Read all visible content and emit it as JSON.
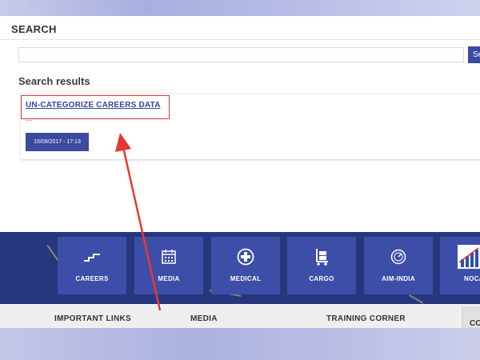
{
  "header": {
    "title": "SEARCH"
  },
  "search": {
    "value": "",
    "placeholder": "",
    "button_label": "Se"
  },
  "results": {
    "heading": "Search results",
    "items": [
      {
        "title": "UN-CATEGORIZE CAREERS DATA",
        "snippet": "...",
        "date": "15/09/2017 - 17:13"
      }
    ]
  },
  "tiles": [
    {
      "label": "CAREERS",
      "icon": "stairs-icon"
    },
    {
      "label": "MEDIA",
      "icon": "calendar-icon"
    },
    {
      "label": "MEDICAL",
      "icon": "medical-cross-icon"
    },
    {
      "label": "CARGO",
      "icon": "cargo-trolley-icon"
    },
    {
      "label": "AIM-INDIA",
      "icon": "gauge-icon"
    },
    {
      "label": "NOCA",
      "icon": "nocas-logo-icon"
    }
  ],
  "footer": {
    "headings": [
      "IMPORTANT LINKS",
      "MEDIA",
      "TRAINING CORNER",
      "CO"
    ]
  },
  "colors": {
    "accent": "#3a4ba6",
    "tile_bg": "#3d4ea8",
    "section_bg": "#27377d",
    "highlight_red": "#d6393a"
  }
}
